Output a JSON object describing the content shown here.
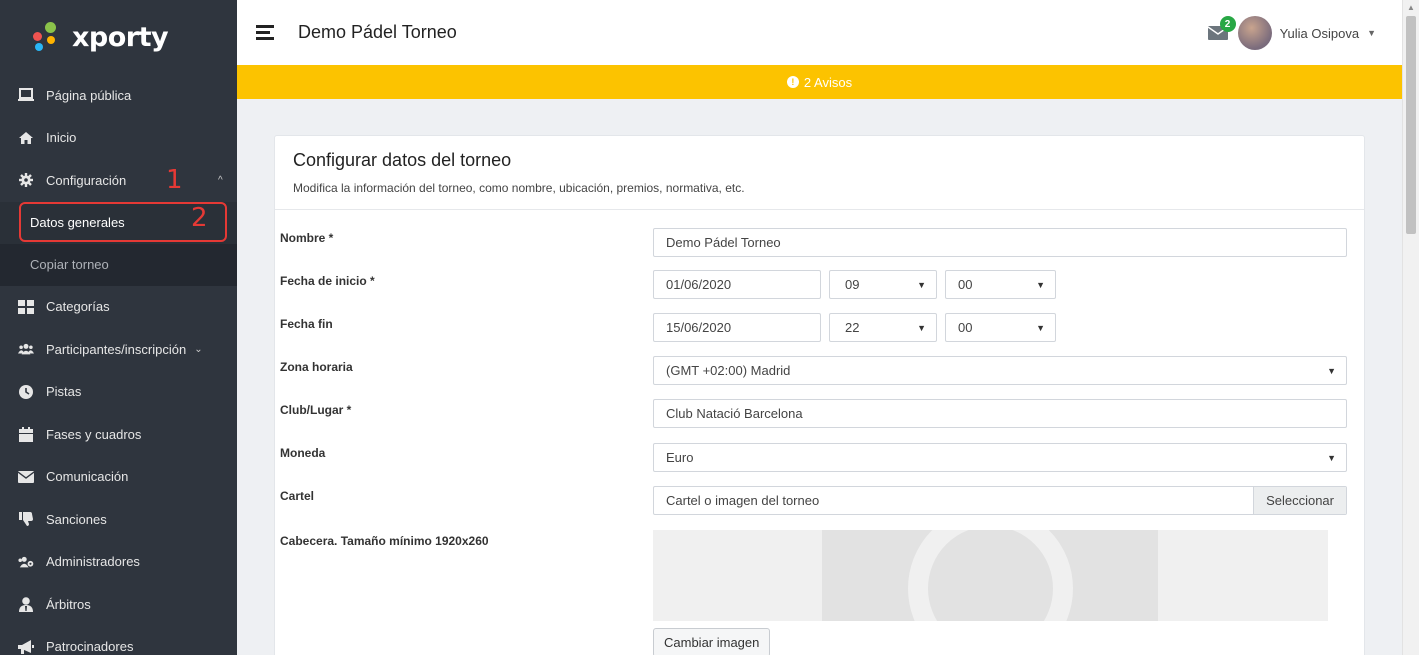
{
  "brand": {
    "name": "xporty"
  },
  "header": {
    "title": "Demo Pádel Torneo",
    "mail_count": "2",
    "user_name": "Yulia Osipova"
  },
  "warning": {
    "text": "2 Avisos"
  },
  "sidebar": {
    "items": [
      {
        "label": "Página pública",
        "icon": "laptop-icon"
      },
      {
        "label": "Inicio",
        "icon": "home-icon"
      },
      {
        "label": "Configuración",
        "icon": "gear-icon"
      },
      {
        "label": "Categorías",
        "icon": "grid-icon"
      },
      {
        "label": "Participantes/inscripción",
        "icon": "users-icon"
      },
      {
        "label": "Pistas",
        "icon": "clock-icon"
      },
      {
        "label": "Fases y cuadros",
        "icon": "calendar-icon"
      },
      {
        "label": "Comunicación",
        "icon": "envelope-icon"
      },
      {
        "label": "Sanciones",
        "icon": "thumbs-down-icon"
      },
      {
        "label": "Administradores",
        "icon": "users-cog-icon"
      },
      {
        "label": "Árbitros",
        "icon": "user-tie-icon"
      },
      {
        "label": "Patrocinadores",
        "icon": "megaphone-icon"
      }
    ],
    "sub_items": [
      {
        "label": "Datos generales"
      },
      {
        "label": "Copiar torneo"
      }
    ]
  },
  "annotations": {
    "step1": "1",
    "step2": "2"
  },
  "form": {
    "title": "Configurar datos del torneo",
    "subtitle": "Modifica la información del torneo, como nombre, ubicación, premios, normativa, etc.",
    "name_label": "Nombre *",
    "name_value": "Demo Pádel Torneo",
    "start_label": "Fecha de inicio *",
    "start_date": "01/06/2020",
    "start_hour": "09",
    "start_min": "00",
    "end_label": "Fecha fin",
    "end_date": "15/06/2020",
    "end_hour": "22",
    "end_min": "00",
    "tz_label": "Zona horaria",
    "tz_value": "(GMT +02:00) Madrid",
    "club_label": "Club/Lugar *",
    "club_value": "Club Natació Barcelona",
    "currency_label": "Moneda",
    "currency_value": "Euro",
    "poster_label": "Cartel",
    "poster_placeholder": "Cartel o imagen del torneo",
    "poster_button": "Seleccionar",
    "header_label": "Cabecera. Tamaño mínimo 1920x260",
    "change_image": "Cambiar imagen"
  },
  "colors": {
    "sidebar": "#2f353e",
    "warning": "#fcc300",
    "highlight": "#e53935",
    "badge": "#28a745"
  }
}
